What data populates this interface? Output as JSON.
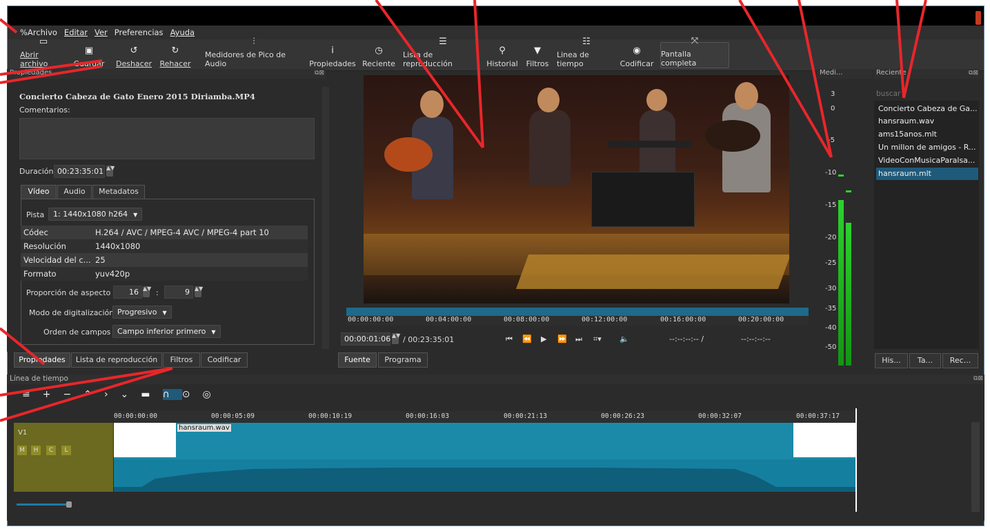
{
  "menu": [
    "%Archivo",
    "Editar",
    "Ver",
    "Preferencias",
    "Ayuda"
  ],
  "toolbar": [
    {
      "label": "Abrir archivo",
      "icon": "folder-icon"
    },
    {
      "label": "Guardar",
      "icon": "save-icon"
    },
    {
      "label": "Deshacer",
      "icon": "undo-icon"
    },
    {
      "label": "Rehacer",
      "icon": "redo-icon"
    },
    {
      "label": "Medidores de Pico de Audio",
      "icon": "audio-meter-icon"
    },
    {
      "label": "Propiedades",
      "icon": "info-icon"
    },
    {
      "label": "Reciente",
      "icon": "clock-icon"
    },
    {
      "label": "Lista de reproducción",
      "icon": "list-icon"
    },
    {
      "label": "Historial",
      "icon": "history-icon"
    },
    {
      "label": "Filtros",
      "icon": "filter-icon"
    },
    {
      "label": "Linea de tiempo",
      "icon": "timeline-icon"
    },
    {
      "label": "Codificar",
      "icon": "encode-icon"
    },
    {
      "label": "Pantalla completa",
      "icon": "fullscreen-icon"
    }
  ],
  "properties": {
    "title": "Propiedades",
    "filename": "Concierto Cabeza de Gato Enero 2015 Diriamba.MP4",
    "comments_label": "Comentarios:",
    "duration_label": "Duración",
    "duration_value": "00:23:35:01",
    "tabs": [
      "Vídeo",
      "Audio",
      "Metadatos"
    ],
    "track_label": "Pista",
    "track_value": "1: 1440x1080 h264",
    "info_rows": [
      [
        "Códec",
        "H.264 / AVC / MPEG-4 AVC / MPEG-4 part 10"
      ],
      [
        "Resolución",
        "1440x1080"
      ],
      [
        "Velocidad del c...",
        "25"
      ],
      [
        "Formato",
        "yuv420p"
      ]
    ],
    "aspect_label": "Proporción de aspecto",
    "aspect_w": "16",
    "aspect_sep": ":",
    "aspect_h": "9",
    "scan_label": "Modo de digitalización",
    "scan_value": "Progresivo",
    "field_label": "Orden de campos",
    "field_value": "Campo inferior primero"
  },
  "bottom_tabs": [
    "Propiedades",
    "Lista de reproducción",
    "Filtros",
    "Codificar"
  ],
  "player": {
    "ruler_ticks": [
      "00:00:00:00",
      "00:04:00:00",
      "00:08:00:00",
      "00:12:00:00",
      "00:16:00:00",
      "00:20:00:00"
    ],
    "position": "00:00:01:06",
    "total": "/ 00:23:35:01",
    "in_point": "--:--:--:-- /",
    "out_point": "--:--:--:--",
    "tabs": [
      "Fuente",
      "Programa"
    ]
  },
  "meter": {
    "title": "Medi...",
    "ticks": [
      "3",
      "0",
      "-5",
      "-10",
      "-15",
      "-20",
      "-25",
      "-30",
      "-35",
      "-40",
      "-50"
    ]
  },
  "recent": {
    "title": "Reciente",
    "search_placeholder": "buscar",
    "items": [
      "Concierto Cabeza de Ga...",
      "hansraum.wav",
      "ams15anos.mlt",
      "Un millon de amigos - R...",
      "VideoConMusicaParalsa...",
      "hansraum.mlt"
    ],
    "buttons": [
      "His...",
      "Ta...",
      "Rec..."
    ]
  },
  "timeline": {
    "title": "Línea de tiempo",
    "ticks": [
      "00:00:00:00",
      "00:00:05:09",
      "00:00:10:19",
      "00:00:16:03",
      "00:00:21:13",
      "00:00:26:23",
      "00:00:32:07",
      "00:00:37:17"
    ],
    "track_name": "V1",
    "track_buttons": [
      "M",
      "H",
      "C",
      "L"
    ],
    "clip_name": "hansraum.wav"
  },
  "colors": {
    "accent": "#1b8aa8",
    "track_header": "#6b6a20",
    "meter_green": "#2dd22d",
    "annotation": "#e8262a"
  }
}
